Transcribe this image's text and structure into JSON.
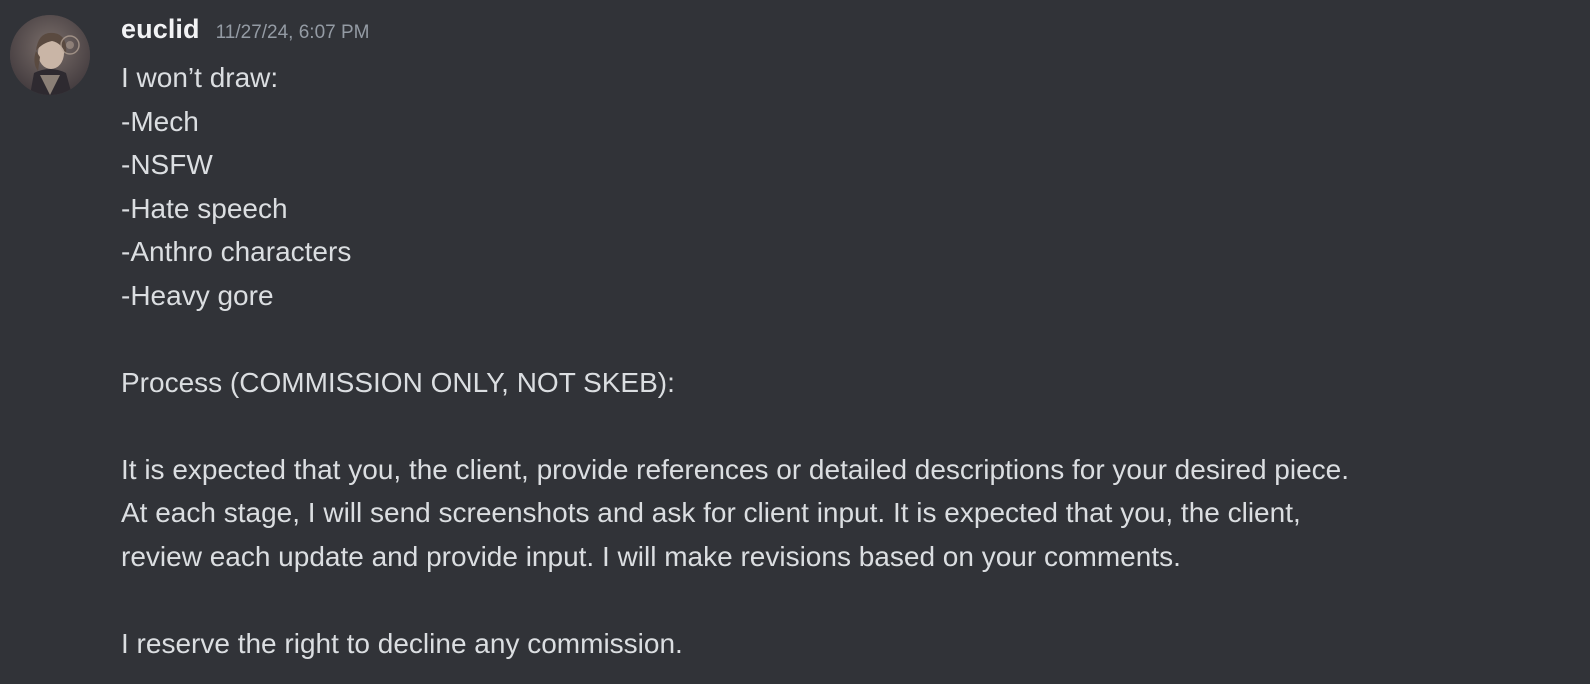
{
  "message": {
    "author": "euclid",
    "timestamp": "11/27/24, 6:07 PM",
    "avatar_icon": "user-avatar-portrait",
    "content": {
      "line1": "I won’t draw:",
      "line2": "-Mech",
      "line3": "-NSFW",
      "line4": "-Hate speech",
      "line5": "-Anthro characters",
      "line6": "-Heavy gore",
      "line7": "Process (COMMISSION ONLY, NOT SKEB):",
      "line8": "It is expected that you, the client, provide references or detailed descriptions for your desired piece.",
      "line9": "At each stage, I will send screenshots and ask for client input. It is expected that you, the client,",
      "line10": "review each update and provide input. I will make revisions based on your comments.",
      "line11": "I reserve the right to decline any commission."
    }
  },
  "colors": {
    "background": "#313338",
    "username": "#f2f3f5",
    "text": "#dbdee1",
    "timestamp": "#949ba4"
  }
}
